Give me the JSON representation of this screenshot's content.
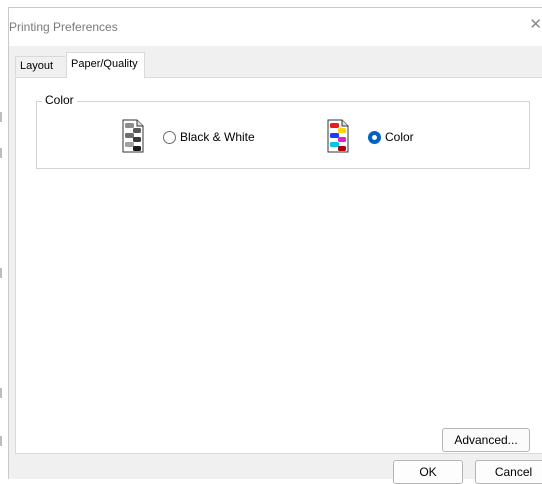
{
  "window": {
    "title": "Printing Preferences",
    "close_glyph": "✕"
  },
  "tabs": [
    {
      "label": "Layout",
      "selected": false
    },
    {
      "label": "Paper/Quality",
      "selected": true
    }
  ],
  "color_group": {
    "legend": "Color",
    "options": [
      {
        "label": "Black & White",
        "selected": false,
        "icon": "grayscale-document-icon"
      },
      {
        "label": "Color",
        "selected": true,
        "icon": "color-document-icon"
      }
    ]
  },
  "buttons": {
    "advanced": "Advanced...",
    "ok": "OK",
    "cancel": "Cancel"
  },
  "colors": {
    "radio_accent": "#0062c4",
    "dialog_bg": "#f0f0f0",
    "panel_bg": "#ffffff"
  }
}
